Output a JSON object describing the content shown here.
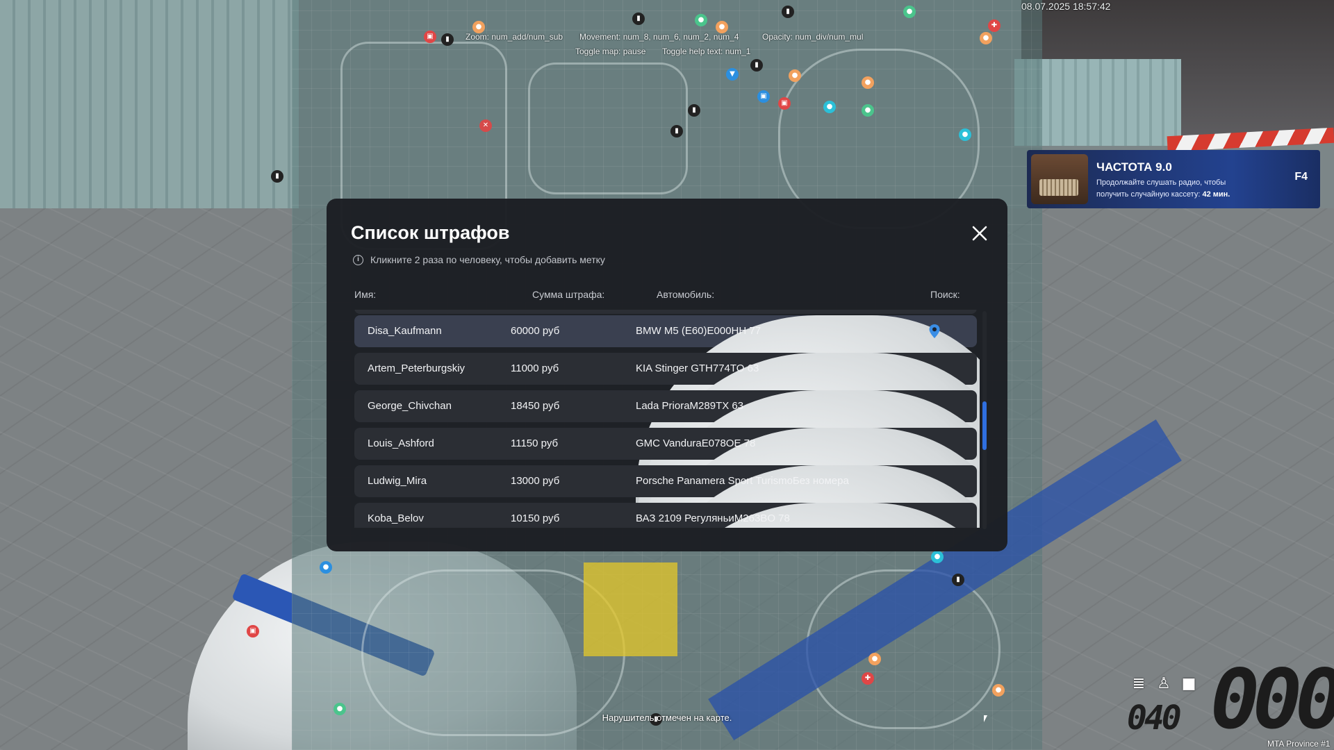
{
  "dialog": {
    "title": "Список штрафов",
    "hint": "Кликните 2 раза по человеку, чтобы добавить метку",
    "columns": {
      "name": "Имя:",
      "fine": "Сумма штрафа:",
      "car": "Автомобиль:",
      "search": "Поиск:"
    },
    "rows": [
      {
        "name": "Disa_Kaufmann",
        "fine": "60000 руб",
        "car": "BMW M5 (E60)E000HH 77",
        "selected": true
      },
      {
        "name": "Artem_Peterburgskiy",
        "fine": "11000 руб",
        "car": "KIA Stinger GTH774TO 63"
      },
      {
        "name": "George_Chivchan",
        "fine": "18450 руб",
        "car": "Lada PrioraM289TX 63"
      },
      {
        "name": "Louis_Ashford",
        "fine": "11150 руб",
        "car": "GMC VanduraE078OE 78"
      },
      {
        "name": "Ludwig_Mira",
        "fine": "13000 руб",
        "car": "Porsche Panamera Sport TurismoБез номера"
      },
      {
        "name": "Koba_Belov",
        "fine": "10150 руб",
        "car": "ВАЗ 2109 РегуляньиM263BO 78"
      }
    ]
  },
  "map": {
    "help": {
      "zoom": "Zoom: num_add/num_sub",
      "movement": "Movement: num_8, num_6, num_2, num_4",
      "opacity": "Opacity: num_div/num_mul",
      "toggle_map": "Toggle map: pause",
      "toggle_help": "Toggle help text: num_1"
    },
    "timestamp": "08.07.2025 18:57:42",
    "notice": "Нарушитель отмечен на карте."
  },
  "radio": {
    "title": "ЧАСТОТА 9.0",
    "text": "Продолжайте слушать радио, чтобы получить случайную кассету:",
    "time": "42 мин.",
    "key": "F4"
  },
  "hud": {
    "speed": "000",
    "fuel": "040"
  },
  "server": "MTA Province #1",
  "colors": {
    "accent": "#2f6fe0",
    "dialog_bg": "#1c1e23",
    "row_bg": "#2b2e34",
    "row_selected": "#3a4050",
    "pin": "#3a8ee6"
  }
}
